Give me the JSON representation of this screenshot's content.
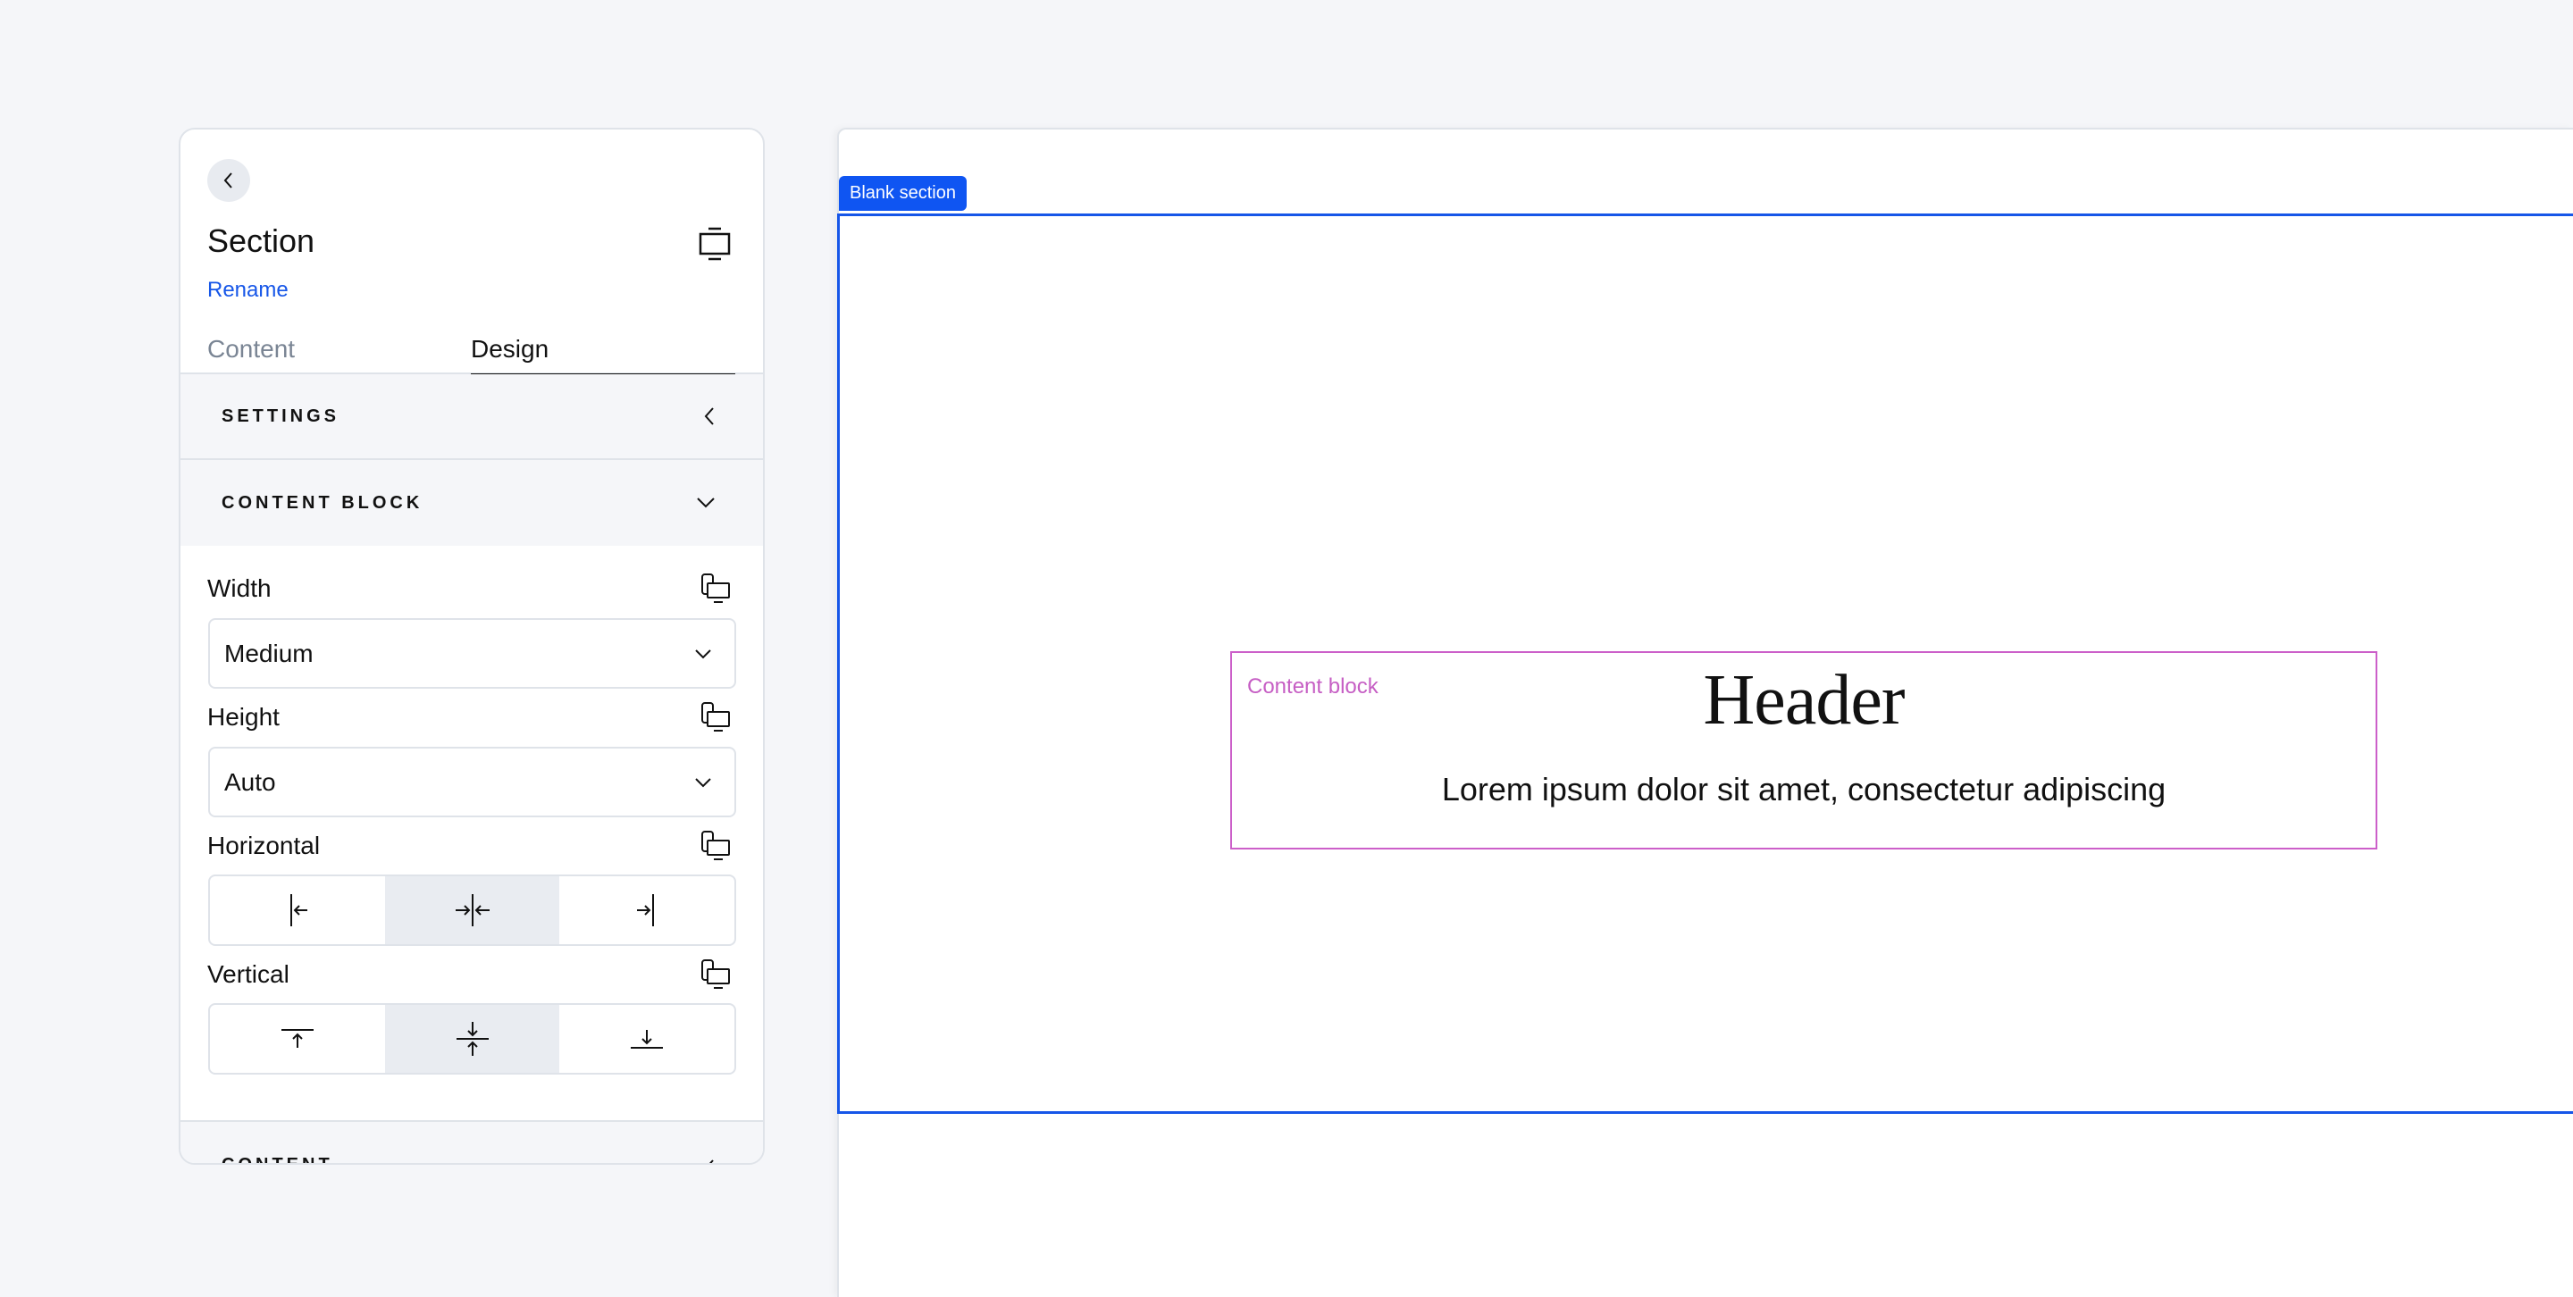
{
  "panel": {
    "title": "Section",
    "rename_label": "Rename",
    "tabs": [
      {
        "label": "Content",
        "active": false
      },
      {
        "label": "Design",
        "active": true
      }
    ],
    "sections": {
      "settings": {
        "label": "SETTINGS",
        "state": "collapsed"
      },
      "content_block": {
        "label": "CONTENT BLOCK",
        "state": "expanded"
      },
      "content": {
        "label": "CONTENT",
        "state": "collapsed"
      }
    },
    "fields": {
      "width": {
        "label": "Width",
        "value": "Medium"
      },
      "height": {
        "label": "Height",
        "value": "Auto"
      },
      "horizontal": {
        "label": "Horizontal",
        "options": [
          "left",
          "center",
          "right"
        ],
        "selected": "center"
      },
      "vertical": {
        "label": "Vertical",
        "options": [
          "top",
          "middle",
          "bottom"
        ],
        "selected": "middle"
      }
    }
  },
  "canvas": {
    "section_tag": "Blank section",
    "content_block": {
      "label": "Content block",
      "header": "Header",
      "body": "Lorem ipsum dolor sit amet, consectetur adipiscing"
    }
  },
  "colors": {
    "accent": "#0f55f2",
    "section_outline": "#1656e8",
    "content_block_outline": "#cc5fc9",
    "background": "#f5f6f9"
  }
}
